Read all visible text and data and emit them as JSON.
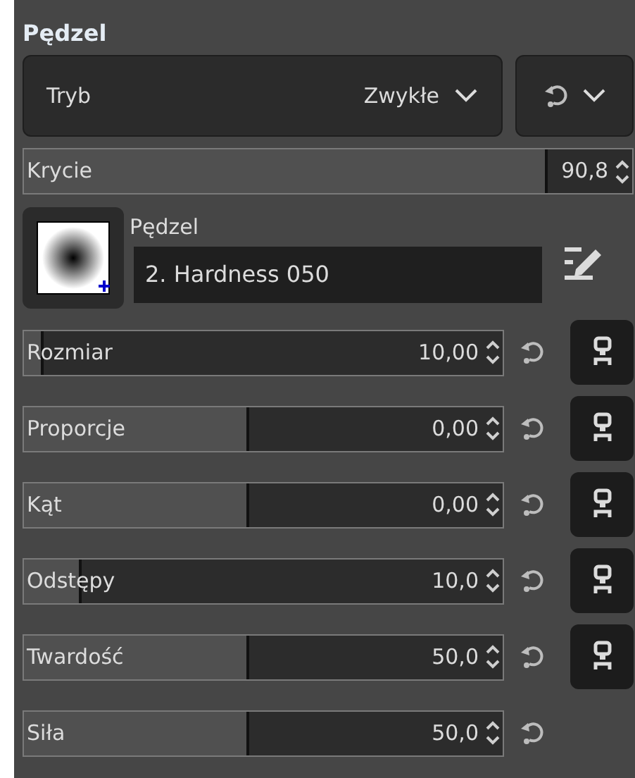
{
  "panel": {
    "title": "Pędzel"
  },
  "mode": {
    "label": "Tryb",
    "value": "Zwykłe"
  },
  "opacity": {
    "label": "Krycie",
    "value": "90,8",
    "level": 0.86
  },
  "brush": {
    "label": "Pędzel",
    "name": "2. Hardness 050"
  },
  "sliders": [
    {
      "label": "Rozmiar",
      "value": "10,00",
      "level": 0.04,
      "lock": true
    },
    {
      "label": "Proporcje",
      "value": "0,00",
      "level": 0.47,
      "lock": true
    },
    {
      "label": "Kąt",
      "value": "0,00",
      "level": 0.47,
      "lock": true
    },
    {
      "label": "Odstępy",
      "value": "10,0",
      "level": 0.12,
      "lock": true
    },
    {
      "label": "Twardość",
      "value": "50,0",
      "level": 0.47,
      "lock": true
    },
    {
      "label": "Siła",
      "value": "50,0",
      "level": 0.47,
      "lock": false
    }
  ]
}
